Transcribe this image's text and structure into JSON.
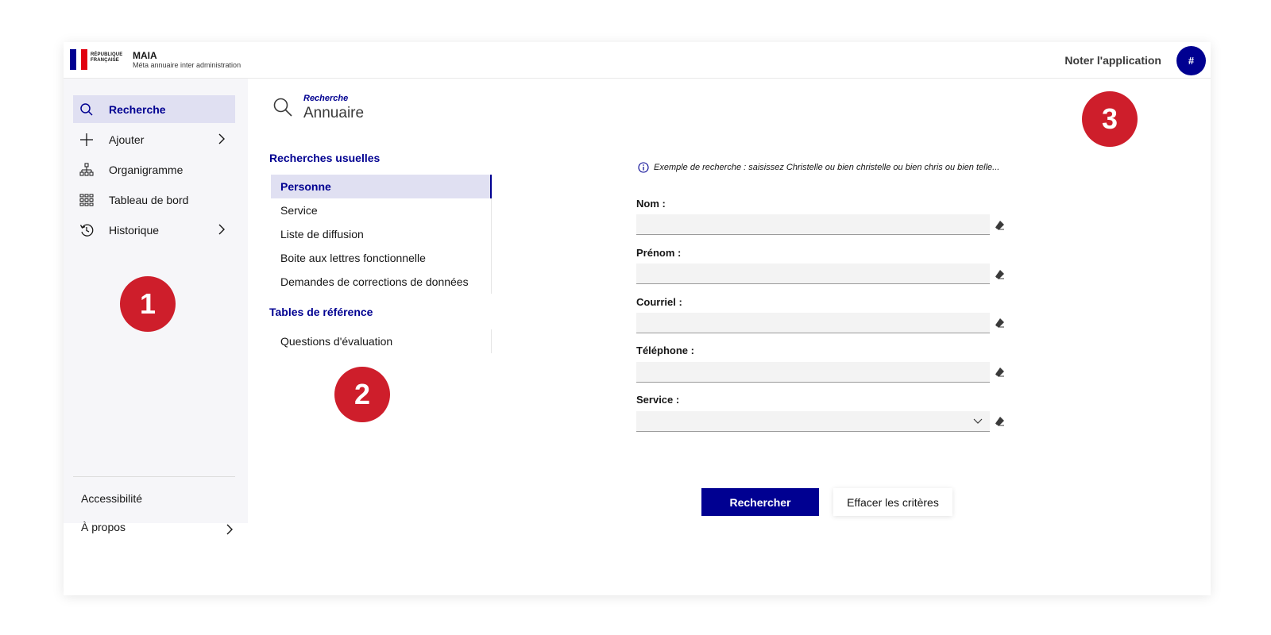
{
  "header": {
    "logo_text_lines": [
      "RÉPUBLIQUE",
      "FRANÇAISE"
    ],
    "app_name": "MAIA",
    "app_subtitle": "Méta annuaire inter administration",
    "rate_link": "Noter l'application",
    "avatar_label": "#"
  },
  "sidebar": {
    "items": [
      {
        "label": "Recherche",
        "icon": "search-icon",
        "active": true
      },
      {
        "label": "Ajouter",
        "icon": "plus-icon",
        "has_chevron": true
      },
      {
        "label": "Organigramme",
        "icon": "org-chart-icon"
      },
      {
        "label": "Tableau de bord",
        "icon": "dashboard-icon"
      },
      {
        "label": "Historique",
        "icon": "history-icon",
        "has_chevron": true
      }
    ],
    "footer": [
      {
        "label": "Accessibilité"
      },
      {
        "label": "À propos",
        "has_chevron": true
      }
    ]
  },
  "badges": [
    "1",
    "2",
    "3"
  ],
  "page": {
    "kicker": "Recherche",
    "title": "Annuaire"
  },
  "search_nav": {
    "usual_title": "Recherches usuelles",
    "usual_items": [
      {
        "label": "Personne",
        "active": true
      },
      {
        "label": "Service"
      },
      {
        "label": "Liste de diffusion"
      },
      {
        "label": "Boite aux lettres fonctionnelle"
      },
      {
        "label": "Demandes de corrections de données"
      }
    ],
    "reference_title": "Tables de référence",
    "reference_items": [
      {
        "label": "Questions d'évaluation"
      }
    ]
  },
  "form": {
    "hint": "Exemple de recherche : saisissez Christelle ou bien christelle ou bien chris ou bien telle...",
    "fields": [
      {
        "label": "Nom :",
        "value": ""
      },
      {
        "label": "Prénom :",
        "value": ""
      },
      {
        "label": "Courriel :",
        "value": ""
      },
      {
        "label": "Téléphone :",
        "value": ""
      },
      {
        "label": "Service :",
        "value": "",
        "type": "select"
      }
    ],
    "submit_label": "Rechercher",
    "reset_label": "Effacer les critères"
  },
  "colors": {
    "primary": "#000091",
    "active_bg": "#e0e0f2",
    "badge": "#ce1e2b",
    "sidebar_bg": "#f6f6f9"
  }
}
